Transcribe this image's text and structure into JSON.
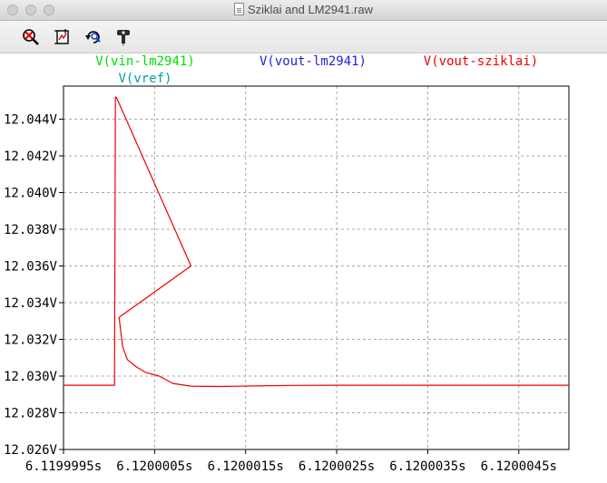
{
  "window": {
    "title": "Sziklai and LM2941.raw"
  },
  "toolbar": {
    "icons": [
      "zoom-cancel-icon",
      "zoom-fit-icon",
      "undo-zoom-icon",
      "probe-icon"
    ]
  },
  "colors": {
    "vin": "#00e000",
    "vout_lm2941": "#2222dd",
    "vout_sziklai": "#ee0000",
    "vref": "#00a0a0",
    "grid": "#a8a8a8",
    "axis": "#000000"
  },
  "chart_data": {
    "type": "line",
    "legend": [
      "V(vin-lm2941)",
      "V(vout-lm2941)",
      "V(vout-sziklai)",
      "V(vref)"
    ],
    "x_tick_labels": [
      "6.1199995s",
      "6.1200005s",
      "6.1200015s",
      "6.1200025s",
      "6.1200035s",
      "6.1200045s"
    ],
    "x_ticks": [
      6.1199995,
      6.1200005,
      6.1200015,
      6.1200025,
      6.1200035,
      6.1200045
    ],
    "xlim": [
      6.1199995,
      6.12000505
    ],
    "y_tick_labels": [
      "12.044V",
      "12.042V",
      "12.040V",
      "12.038V",
      "12.036V",
      "12.034V",
      "12.032V",
      "12.030V",
      "12.028V",
      "12.026V"
    ],
    "y_ticks": [
      12.044,
      12.042,
      12.04,
      12.038,
      12.036,
      12.034,
      12.032,
      12.03,
      12.028,
      12.026
    ],
    "ylim": [
      12.026,
      12.0458
    ],
    "grid": true,
    "series": [
      {
        "name": "V(vout-sziklai)",
        "color": "#ee0000",
        "x": [
          6.1199995,
          6.12,
          6.12000003,
          6.12000006,
          6.12000007,
          6.12000008,
          6.1200009,
          6.12000011,
          6.12000015,
          6.1200002,
          6.1200003,
          6.1200004,
          6.12000055,
          6.1200007,
          6.1200009,
          6.1200012,
          6.1200016,
          6.120002,
          6.1200025,
          6.120003,
          6.1200035,
          6.120004,
          6.1200045,
          6.12000505
        ],
        "y": [
          12.0295,
          12.0295,
          12.0295,
          12.0295,
          12.0452,
          12.0452,
          12.036,
          12.0332,
          12.0316,
          12.0309,
          12.0305,
          12.0302,
          12.03,
          12.0296,
          12.02945,
          12.02943,
          12.02946,
          12.02949,
          12.0295,
          12.0295,
          12.0295,
          12.0295,
          12.0295,
          12.0295
        ]
      }
    ]
  }
}
